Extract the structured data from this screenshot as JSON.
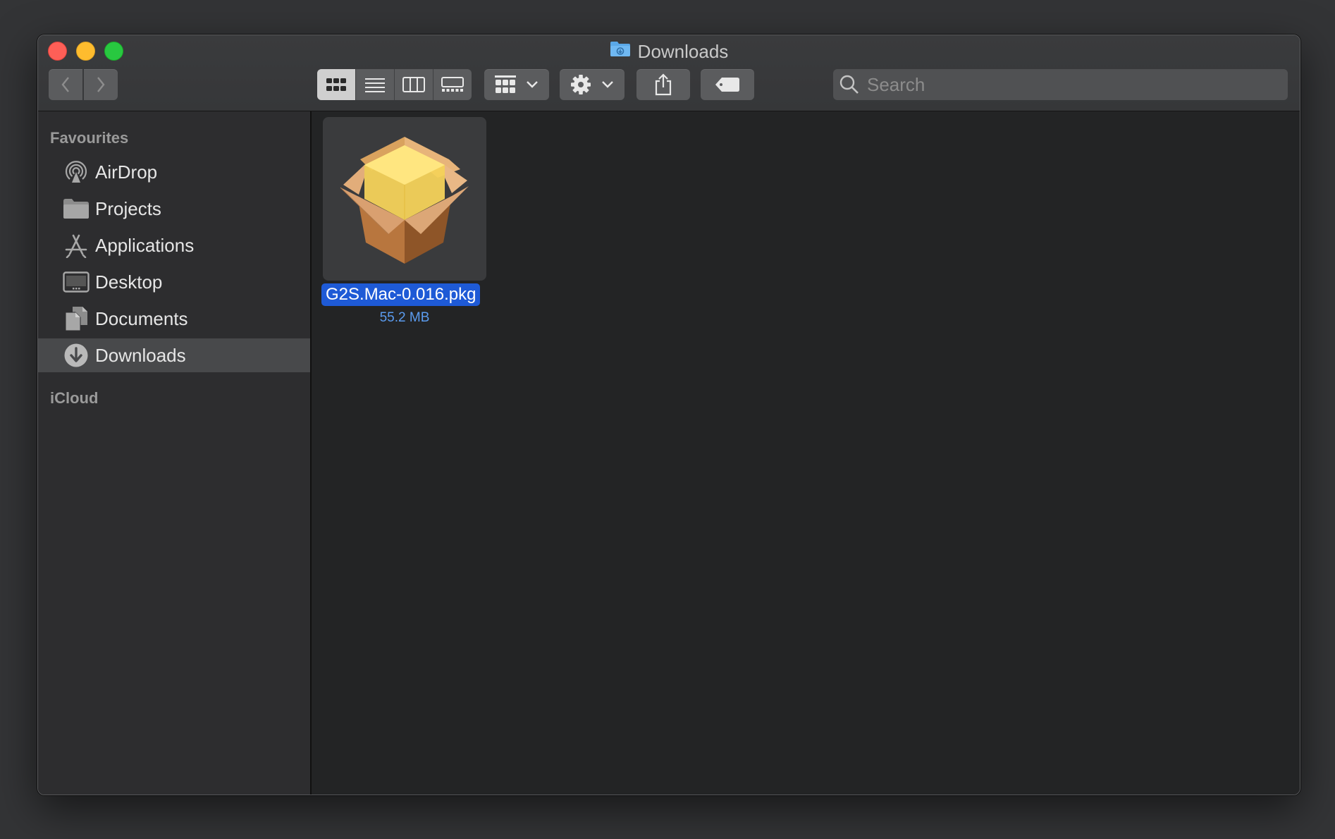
{
  "window": {
    "title": "Downloads",
    "title_icon": "blue-folder-icon"
  },
  "toolbar": {
    "back_icon": "chevron-left-icon",
    "forward_icon": "chevron-right-icon",
    "view_modes": [
      "icon-view",
      "list-view",
      "column-view",
      "gallery-view"
    ],
    "active_view": "icon-view",
    "group_icon": "grid-group-icon",
    "action_icon": "gear-icon",
    "share_icon": "share-icon",
    "tag_icon": "tag-icon"
  },
  "search": {
    "placeholder": "Search",
    "value": ""
  },
  "sidebar": {
    "favourites_label": "Favourites",
    "icloud_label": "iCloud",
    "items": [
      {
        "label": "AirDrop",
        "icon": "airdrop-icon"
      },
      {
        "label": "Projects",
        "icon": "folder-icon"
      },
      {
        "label": "Applications",
        "icon": "applications-icon"
      },
      {
        "label": "Desktop",
        "icon": "desktop-icon"
      },
      {
        "label": "Documents",
        "icon": "documents-icon"
      },
      {
        "label": "Downloads",
        "icon": "downloads-icon",
        "selected": true
      }
    ]
  },
  "files": [
    {
      "name": "G2S.Mac-0.016.pkg",
      "size": "55.2 MB",
      "icon": "package-icon",
      "selected": true
    }
  ],
  "colors": {
    "selection": "#1e5ad6",
    "size_text": "#5b9cf0",
    "close": "#fe5f57",
    "minimize": "#febc2e",
    "maximize": "#28c840"
  }
}
